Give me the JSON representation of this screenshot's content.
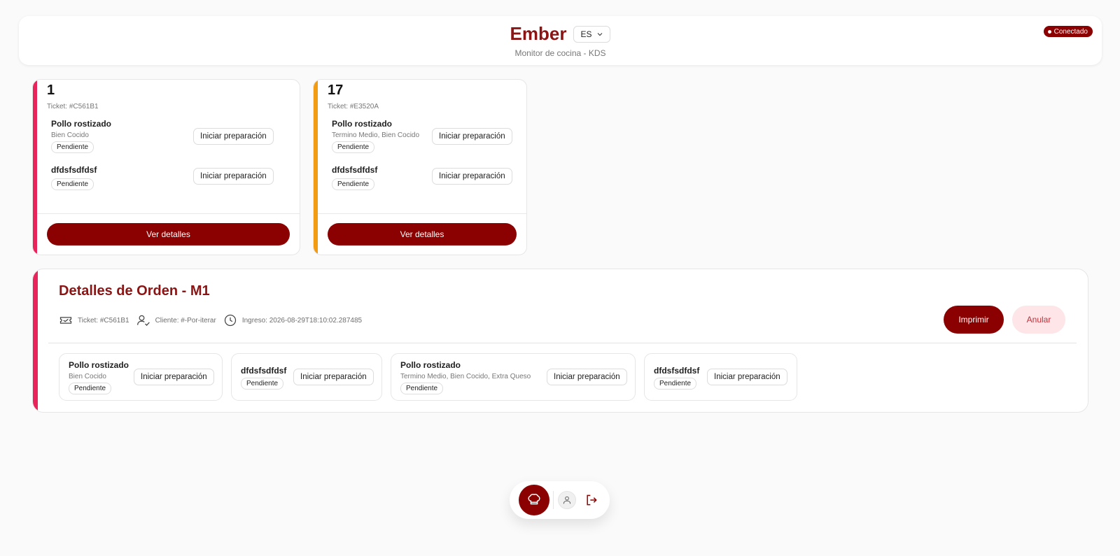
{
  "header": {
    "title": "Ember",
    "language": "ES",
    "subtitle": "Monitor de cocina - KDS",
    "status": "Conectado"
  },
  "orders": [
    {
      "number": "1",
      "ticket": "Ticket: #C561B1",
      "accent": "#e8245a",
      "items": [
        {
          "name": "Pollo rostizado",
          "mods": "Bien Cocido",
          "status": "Pendiente",
          "action": "Iniciar preparación"
        },
        {
          "name": "dfdsfsdfdsf",
          "status": "Pendiente",
          "action": "Iniciar preparación"
        }
      ],
      "details_label": "Ver detalles"
    },
    {
      "number": "17",
      "ticket": "Ticket: #E3520A",
      "accent": "#f39c12",
      "items": [
        {
          "name": "Pollo rostizado",
          "mods": "Termino Medio, Bien Cocido",
          "status": "Pendiente",
          "action": "Iniciar preparación"
        },
        {
          "name": "dfdsfsdfdsf",
          "status": "Pendiente",
          "action": "Iniciar preparación"
        }
      ],
      "details_label": "Ver detalles"
    }
  ],
  "details": {
    "title": "Detalles de Orden - M1",
    "ticket": "Ticket: #C561B1",
    "client": "Cliente: #-Por-iterar",
    "ingreso": "Ingreso: 2026-08-29T18:10:02.287485",
    "print_label": "Imprimir",
    "cancel_label": "Anular",
    "items": [
      {
        "name": "Pollo rostizado",
        "mods": "Bien Cocido",
        "status": "Pendiente",
        "action": "Iniciar preparación"
      },
      {
        "name": "dfdsfsdfdsf",
        "status": "Pendiente",
        "action": "Iniciar preparación"
      },
      {
        "name": "Pollo rostizado",
        "mods": "Termino Medio, Bien Cocido, Extra Queso",
        "status": "Pendiente",
        "action": "Iniciar preparación"
      },
      {
        "name": "dfdsfsdfdsf",
        "status": "Pendiente",
        "action": "Iniciar preparación"
      }
    ]
  },
  "nav": {
    "icons": [
      "chef-hat-icon",
      "user-icon",
      "logout-icon"
    ],
    "active_color": "#8b0000"
  },
  "colors": {
    "brand": "#8b0000",
    "title": "#8b1414",
    "accent_pink": "#e8245a",
    "accent_orange": "#f39c12",
    "cancel_bg": "#fde5e8"
  }
}
